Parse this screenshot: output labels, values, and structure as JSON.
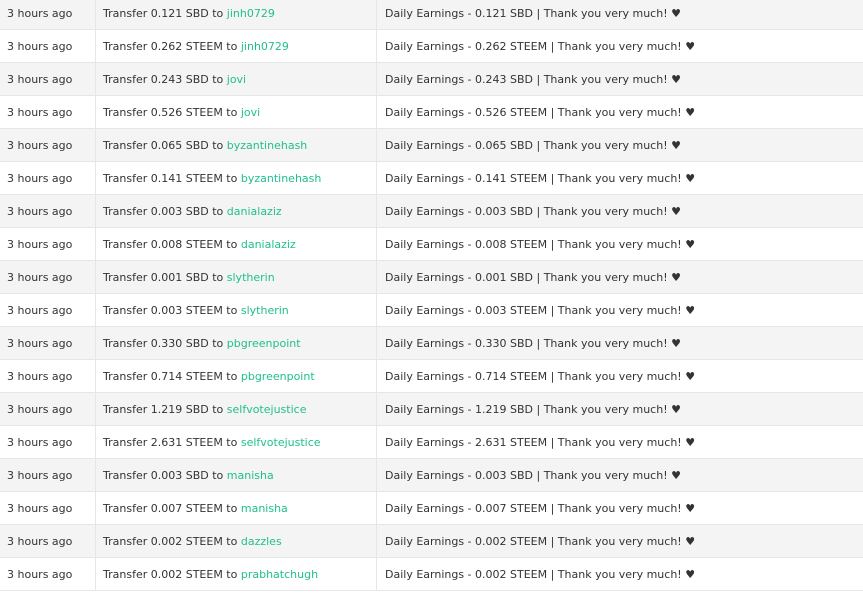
{
  "colors": {
    "link": "#1fbf8f",
    "text": "#333333",
    "row_alt": "#f4f4f4",
    "border": "#e6e6e6"
  },
  "rows": [
    {
      "time": "3 hours ago",
      "op_prefix": "Transfer 0.121 SBD to",
      "account": "jinh0729",
      "memo": "Daily Earnings - 0.121 SBD | Thank you very much! ♥"
    },
    {
      "time": "3 hours ago",
      "op_prefix": "Transfer 0.262 STEEM to",
      "account": "jinh0729",
      "memo": "Daily Earnings - 0.262 STEEM | Thank you very much! ♥"
    },
    {
      "time": "3 hours ago",
      "op_prefix": "Transfer 0.243 SBD to",
      "account": "jovi",
      "memo": "Daily Earnings - 0.243 SBD | Thank you very much! ♥"
    },
    {
      "time": "3 hours ago",
      "op_prefix": "Transfer 0.526 STEEM to",
      "account": "jovi",
      "memo": "Daily Earnings - 0.526 STEEM | Thank you very much! ♥"
    },
    {
      "time": "3 hours ago",
      "op_prefix": "Transfer 0.065 SBD to",
      "account": "byzantinehash",
      "memo": "Daily Earnings - 0.065 SBD | Thank you very much! ♥"
    },
    {
      "time": "3 hours ago",
      "op_prefix": "Transfer 0.141 STEEM to",
      "account": "byzantinehash",
      "memo": "Daily Earnings - 0.141 STEEM | Thank you very much! ♥"
    },
    {
      "time": "3 hours ago",
      "op_prefix": "Transfer 0.003 SBD to",
      "account": "danialaziz",
      "memo": "Daily Earnings - 0.003 SBD | Thank you very much! ♥"
    },
    {
      "time": "3 hours ago",
      "op_prefix": "Transfer 0.008 STEEM to",
      "account": "danialaziz",
      "memo": "Daily Earnings - 0.008 STEEM | Thank you very much! ♥"
    },
    {
      "time": "3 hours ago",
      "op_prefix": "Transfer 0.001 SBD to",
      "account": "slytherin",
      "memo": "Daily Earnings - 0.001 SBD | Thank you very much! ♥"
    },
    {
      "time": "3 hours ago",
      "op_prefix": "Transfer 0.003 STEEM to",
      "account": "slytherin",
      "memo": "Daily Earnings - 0.003 STEEM | Thank you very much! ♥"
    },
    {
      "time": "3 hours ago",
      "op_prefix": "Transfer 0.330 SBD to",
      "account": "pbgreenpoint",
      "memo": "Daily Earnings - 0.330 SBD | Thank you very much! ♥"
    },
    {
      "time": "3 hours ago",
      "op_prefix": "Transfer 0.714 STEEM to",
      "account": "pbgreenpoint",
      "memo": "Daily Earnings - 0.714 STEEM | Thank you very much! ♥"
    },
    {
      "time": "3 hours ago",
      "op_prefix": "Transfer 1.219 SBD to",
      "account": "selfvotejustice",
      "memo": "Daily Earnings - 1.219 SBD | Thank you very much! ♥"
    },
    {
      "time": "3 hours ago",
      "op_prefix": "Transfer 2.631 STEEM to",
      "account": "selfvotejustice",
      "memo": "Daily Earnings - 2.631 STEEM | Thank you very much! ♥"
    },
    {
      "time": "3 hours ago",
      "op_prefix": "Transfer 0.003 SBD to",
      "account": "manisha",
      "memo": "Daily Earnings - 0.003 SBD | Thank you very much! ♥"
    },
    {
      "time": "3 hours ago",
      "op_prefix": "Transfer 0.007 STEEM to",
      "account": "manisha",
      "memo": "Daily Earnings - 0.007 STEEM | Thank you very much! ♥"
    },
    {
      "time": "3 hours ago",
      "op_prefix": "Transfer 0.002 STEEM to",
      "account": "dazzles",
      "memo": "Daily Earnings - 0.002 STEEM | Thank you very much! ♥"
    },
    {
      "time": "3 hours ago",
      "op_prefix": "Transfer 0.002 STEEM to",
      "account": "prabhatchugh",
      "memo": "Daily Earnings - 0.002 STEEM | Thank you very much! ♥"
    }
  ]
}
